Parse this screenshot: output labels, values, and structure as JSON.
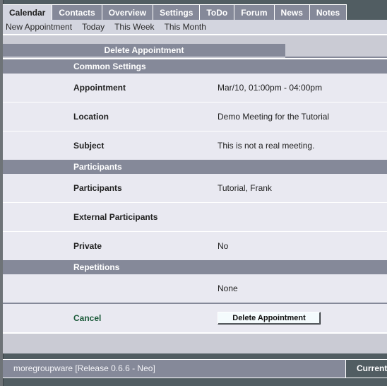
{
  "tabs": [
    {
      "label": "Calendar",
      "active": true
    },
    {
      "label": "Contacts"
    },
    {
      "label": "Overview"
    },
    {
      "label": "Settings"
    },
    {
      "label": "ToDo"
    },
    {
      "label": "Forum"
    },
    {
      "label": "News"
    },
    {
      "label": "Notes"
    }
  ],
  "subnav": [
    "New Appointment",
    "Today",
    "This Week",
    "This Month"
  ],
  "page_title": "Delete Appointment",
  "sections": {
    "common": {
      "title": "Common Settings",
      "rows": [
        {
          "label": "Appointment",
          "value": "Mar/10, 01:00pm - 04:00pm"
        },
        {
          "label": "Location",
          "value": "Demo Meeting for the Tutorial"
        },
        {
          "label": "Subject",
          "value": "This is not a real meeting."
        }
      ]
    },
    "participants": {
      "title": "Participants",
      "rows": [
        {
          "label": "Participants",
          "value": "Tutorial, Frank"
        },
        {
          "label": "External Participants",
          "value": ""
        },
        {
          "label": "Private",
          "value": "No"
        }
      ]
    },
    "repetitions": {
      "title": "Repetitions",
      "rows": [
        {
          "label": "",
          "value": "None"
        }
      ]
    }
  },
  "actions": {
    "cancel_label": "Cancel",
    "delete_label": "Delete Appointment"
  },
  "footer": {
    "release": "moregroupware [Release 0.6.6 - Neo]",
    "current": "Current"
  }
}
